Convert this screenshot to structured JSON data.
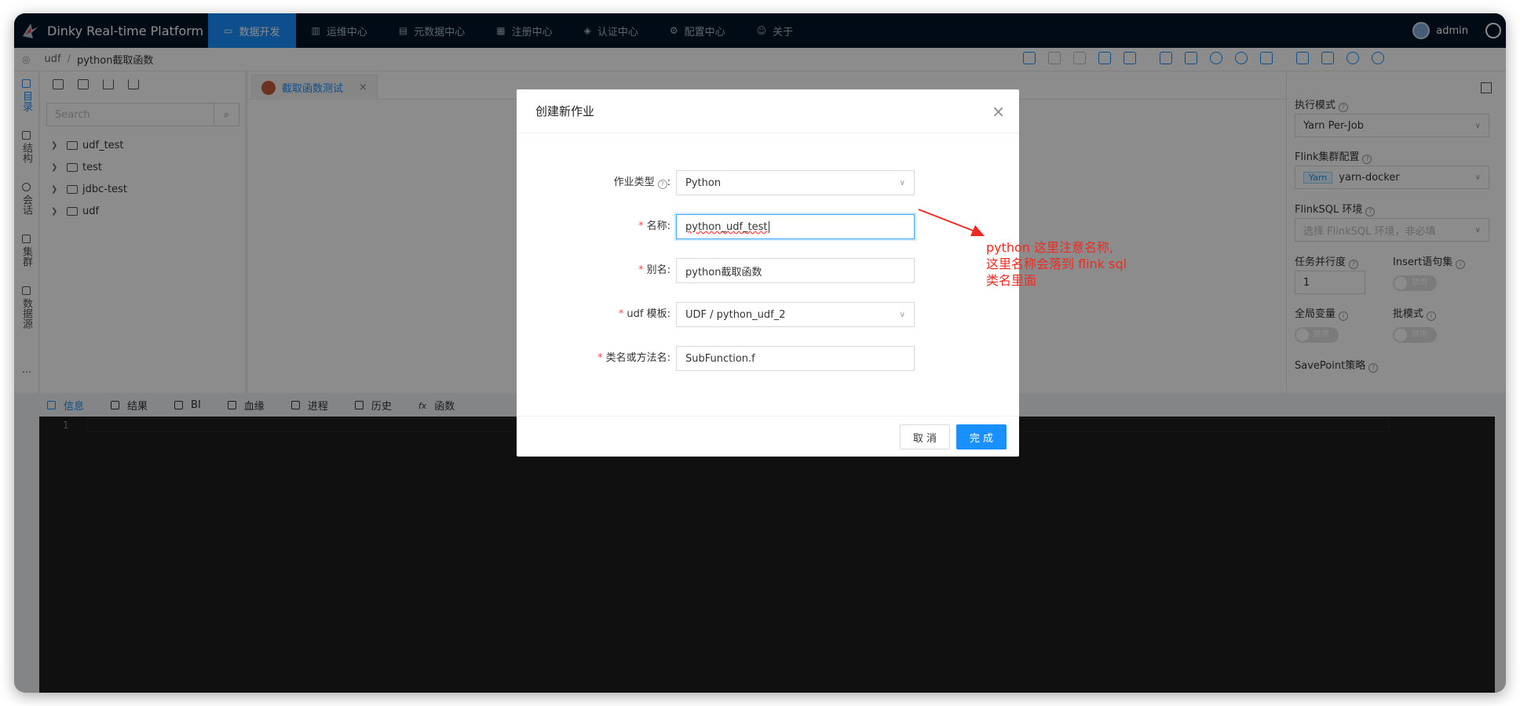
{
  "app": {
    "brand": "Dinky Real-time Platform",
    "nav": [
      {
        "label": "数据开发",
        "icon": "monitor-icon",
        "active": true
      },
      {
        "label": "运维中心",
        "icon": "dashboard-icon"
      },
      {
        "label": "元数据中心",
        "icon": "table-icon"
      },
      {
        "label": "注册中心",
        "icon": "grid-icon"
      },
      {
        "label": "认证中心",
        "icon": "shield-icon"
      },
      {
        "label": "配置中心",
        "icon": "gear-icon"
      },
      {
        "label": "关于",
        "icon": "smile-icon"
      }
    ],
    "user": "admin"
  },
  "breadcrumb": {
    "root": "udf",
    "sep": "/",
    "current": "python截取函数"
  },
  "side_tabs": [
    "目录",
    "结构",
    "会话",
    "集群",
    "数据源",
    "..."
  ],
  "directory": {
    "search_placeholder": "Search",
    "folders": [
      "udf_test",
      "test",
      "jdbc-test",
      "udf"
    ]
  },
  "editor": {
    "tab_label": "截取函数测试",
    "close_glyph": "×"
  },
  "right_panel": {
    "exec_mode_label": "执行模式",
    "exec_mode_value": "Yarn Per-Job",
    "cluster_label": "Flink集群配置",
    "cluster_tag": "Yarn",
    "cluster_value": "yarn-docker",
    "env_label": "FlinkSQL 环境",
    "env_placeholder": "选择 FlinkSQL 环境，非必填",
    "parallel_label": "任务并行度",
    "parallel_value": "1",
    "insert_label": "Insert语句集",
    "insert_toggle": "禁用",
    "global_var_label": "全局变量",
    "global_var_toggle": "禁用",
    "batch_label": "批模式",
    "batch_toggle": "禁用",
    "savepoint_label": "SavePoint策略"
  },
  "bottom_tabs": [
    "信息",
    "结果",
    "BI",
    "血缘",
    "进程",
    "历史",
    "函数"
  ],
  "console": {
    "line": "1"
  },
  "modal": {
    "title": "创建新作业",
    "close": "×",
    "fields": [
      {
        "label": "作业类型",
        "required": false,
        "help": true,
        "value": "Python",
        "kind": "select"
      },
      {
        "label": "名称",
        "required": true,
        "value": "python_udf_test",
        "kind": "input-focus"
      },
      {
        "label": "别名",
        "required": true,
        "value": "python截取函数",
        "kind": "input"
      },
      {
        "label": "udf 模板",
        "required": true,
        "value": "UDF / python_udf_2",
        "kind": "select"
      },
      {
        "label": "类名或方法名",
        "required": true,
        "value": "SubFunction.f",
        "kind": "input"
      }
    ],
    "colon": ":",
    "cancel": "取 消",
    "ok": "完 成"
  },
  "annotation": {
    "lines": [
      "python 这里注意名称,",
      "这里名称会落到 flink sql",
      "类名里面"
    ],
    "color": "#f02a20"
  }
}
